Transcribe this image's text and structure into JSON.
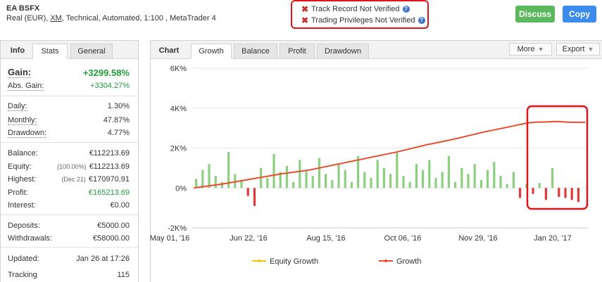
{
  "header": {
    "title": "EA BSFX",
    "subtitle_pre": "Real (EUR), ",
    "broker": "XM",
    "subtitle_post": ", Technical, Automated, 1:100 , MetaTrader 4",
    "verify": [
      {
        "text": "Track Record Not Verified",
        "icon": "x-icon"
      },
      {
        "text": "Trading Privileges Not Verified",
        "icon": "x-icon"
      }
    ],
    "discuss_label": "Discuss",
    "copy_label": "Copy",
    "colors": {
      "discuss": "#5cb85c",
      "copy": "#3b8ced",
      "highlight": "#e0141a"
    }
  },
  "left_tabs": {
    "info": "Info",
    "stats": "Stats",
    "general": "General"
  },
  "stats": {
    "gain": {
      "label": "Gain:",
      "value": "+3299.58%"
    },
    "abs_gain": {
      "label": "Abs. Gain:",
      "value": "+3304.27%"
    },
    "daily": {
      "label": "Daily:",
      "value": "1.30%"
    },
    "monthly": {
      "label": "Monthly:",
      "value": "47.87%"
    },
    "drawdown": {
      "label": "Drawdown:",
      "value": "4.77%"
    },
    "balance": {
      "label": "Balance:",
      "value": "€112213.69"
    },
    "equity": {
      "label": "Equity:",
      "note": "(100.00%)",
      "value": "€112213.69"
    },
    "highest": {
      "label": "Highest:",
      "note": "(Dec 21)",
      "value": "€170970.91"
    },
    "profit": {
      "label": "Profit:",
      "value": "€165213.69"
    },
    "interest": {
      "label": "Interest:",
      "value": "€0.00"
    },
    "deposits": {
      "label": "Deposits:",
      "value": "€5000.00"
    },
    "withdrawals": {
      "label": "Withdrawals:",
      "value": "€58000.00"
    },
    "updated": {
      "label": "Updated:",
      "value": "Jan 26 at 17:26"
    },
    "tracking": {
      "label": "Tracking",
      "value": "115"
    }
  },
  "chart_tabs": {
    "label": "Chart",
    "growth": "Growth",
    "balance": "Balance",
    "profit": "Profit",
    "drawdown": "Drawdown",
    "more": "More",
    "export": "Export"
  },
  "chart_data": {
    "type": "line",
    "yticks": [
      "6K%",
      "4K%",
      "2K%",
      "0%",
      "-2K%"
    ],
    "ylim": [
      -2000,
      6000
    ],
    "xticks": [
      "May 01, '16",
      "Jun 22, '16",
      "Aug 15, '16",
      "Oct 06, '16",
      "Nov 29, '16",
      "Jan 20, '17"
    ],
    "legend": [
      "Equity Growth",
      "Growth"
    ],
    "legend_position": "bottom",
    "colors": {
      "equity": "#f2c40f",
      "growth": "#e74c2c",
      "bars_pos": "#8ccf7e",
      "bars_neg": "#e23a3a",
      "highlight": "#e0141a"
    },
    "growth_line": {
      "x_index": [
        0,
        10,
        20,
        30,
        40,
        50,
        60,
        70,
        80,
        90,
        100,
        110,
        115,
        118,
        120,
        125,
        130,
        135
      ],
      "values": [
        0,
        200,
        450,
        700,
        900,
        1200,
        1500,
        1800,
        2150,
        2450,
        2800,
        3100,
        3250,
        3300,
        3300,
        3330,
        3290,
        3290
      ]
    },
    "bars_sample": [
      450,
      900,
      1200,
      600,
      300,
      1800,
      700,
      400,
      -400,
      -900,
      1000,
      500,
      1700,
      800,
      1100,
      300,
      1400,
      900,
      600,
      1500,
      700,
      400,
      1200,
      900,
      300,
      1600,
      800,
      500,
      1400,
      1000,
      700,
      1800,
      600,
      300,
      1200,
      900,
      1400,
      500,
      800,
      1600,
      300,
      1000,
      700,
      1200,
      400,
      900,
      1300,
      600,
      200,
      800,
      -500,
      200,
      -300,
      250,
      -600,
      1000,
      -450,
      -500,
      -600,
      -700
    ]
  }
}
